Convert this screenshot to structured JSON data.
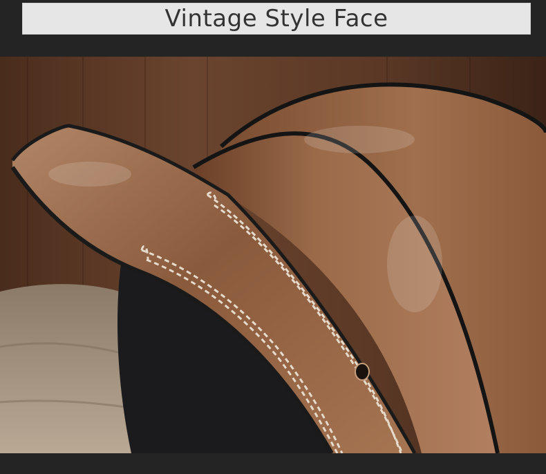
{
  "header": {
    "title": "Vintage Style Face"
  },
  "photo": {
    "subject": "belt-photo"
  },
  "colors": {
    "page_bg": "#242424",
    "title_bg": "#e6e6e6",
    "title_text": "#333333",
    "leather_light": "#a47453",
    "leather_dark": "#6e4329",
    "stitch": "#e6dccd",
    "wood": "#5d3a27"
  }
}
